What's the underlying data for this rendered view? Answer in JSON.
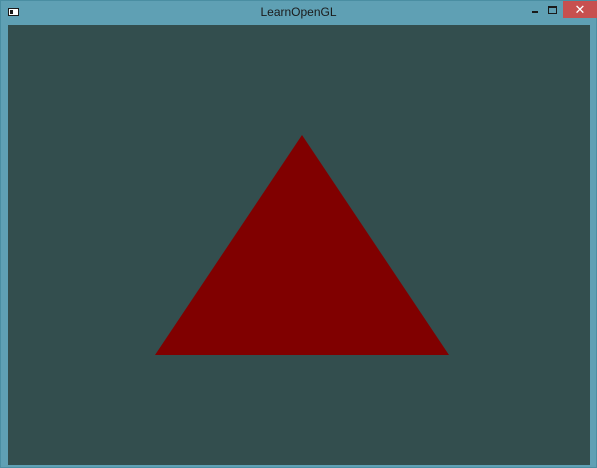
{
  "window": {
    "title": "LearnOpenGL",
    "icons": {
      "app": "app-window-icon",
      "minimize": "minimize-icon",
      "maximize": "maximize-icon",
      "close": "close-icon"
    },
    "close_glyph": "✕"
  },
  "scene": {
    "clear_color": "#334e4e",
    "triangle_color": "#800000",
    "frame_color": "#5fa0b4",
    "close_button_color": "#c7504f"
  }
}
